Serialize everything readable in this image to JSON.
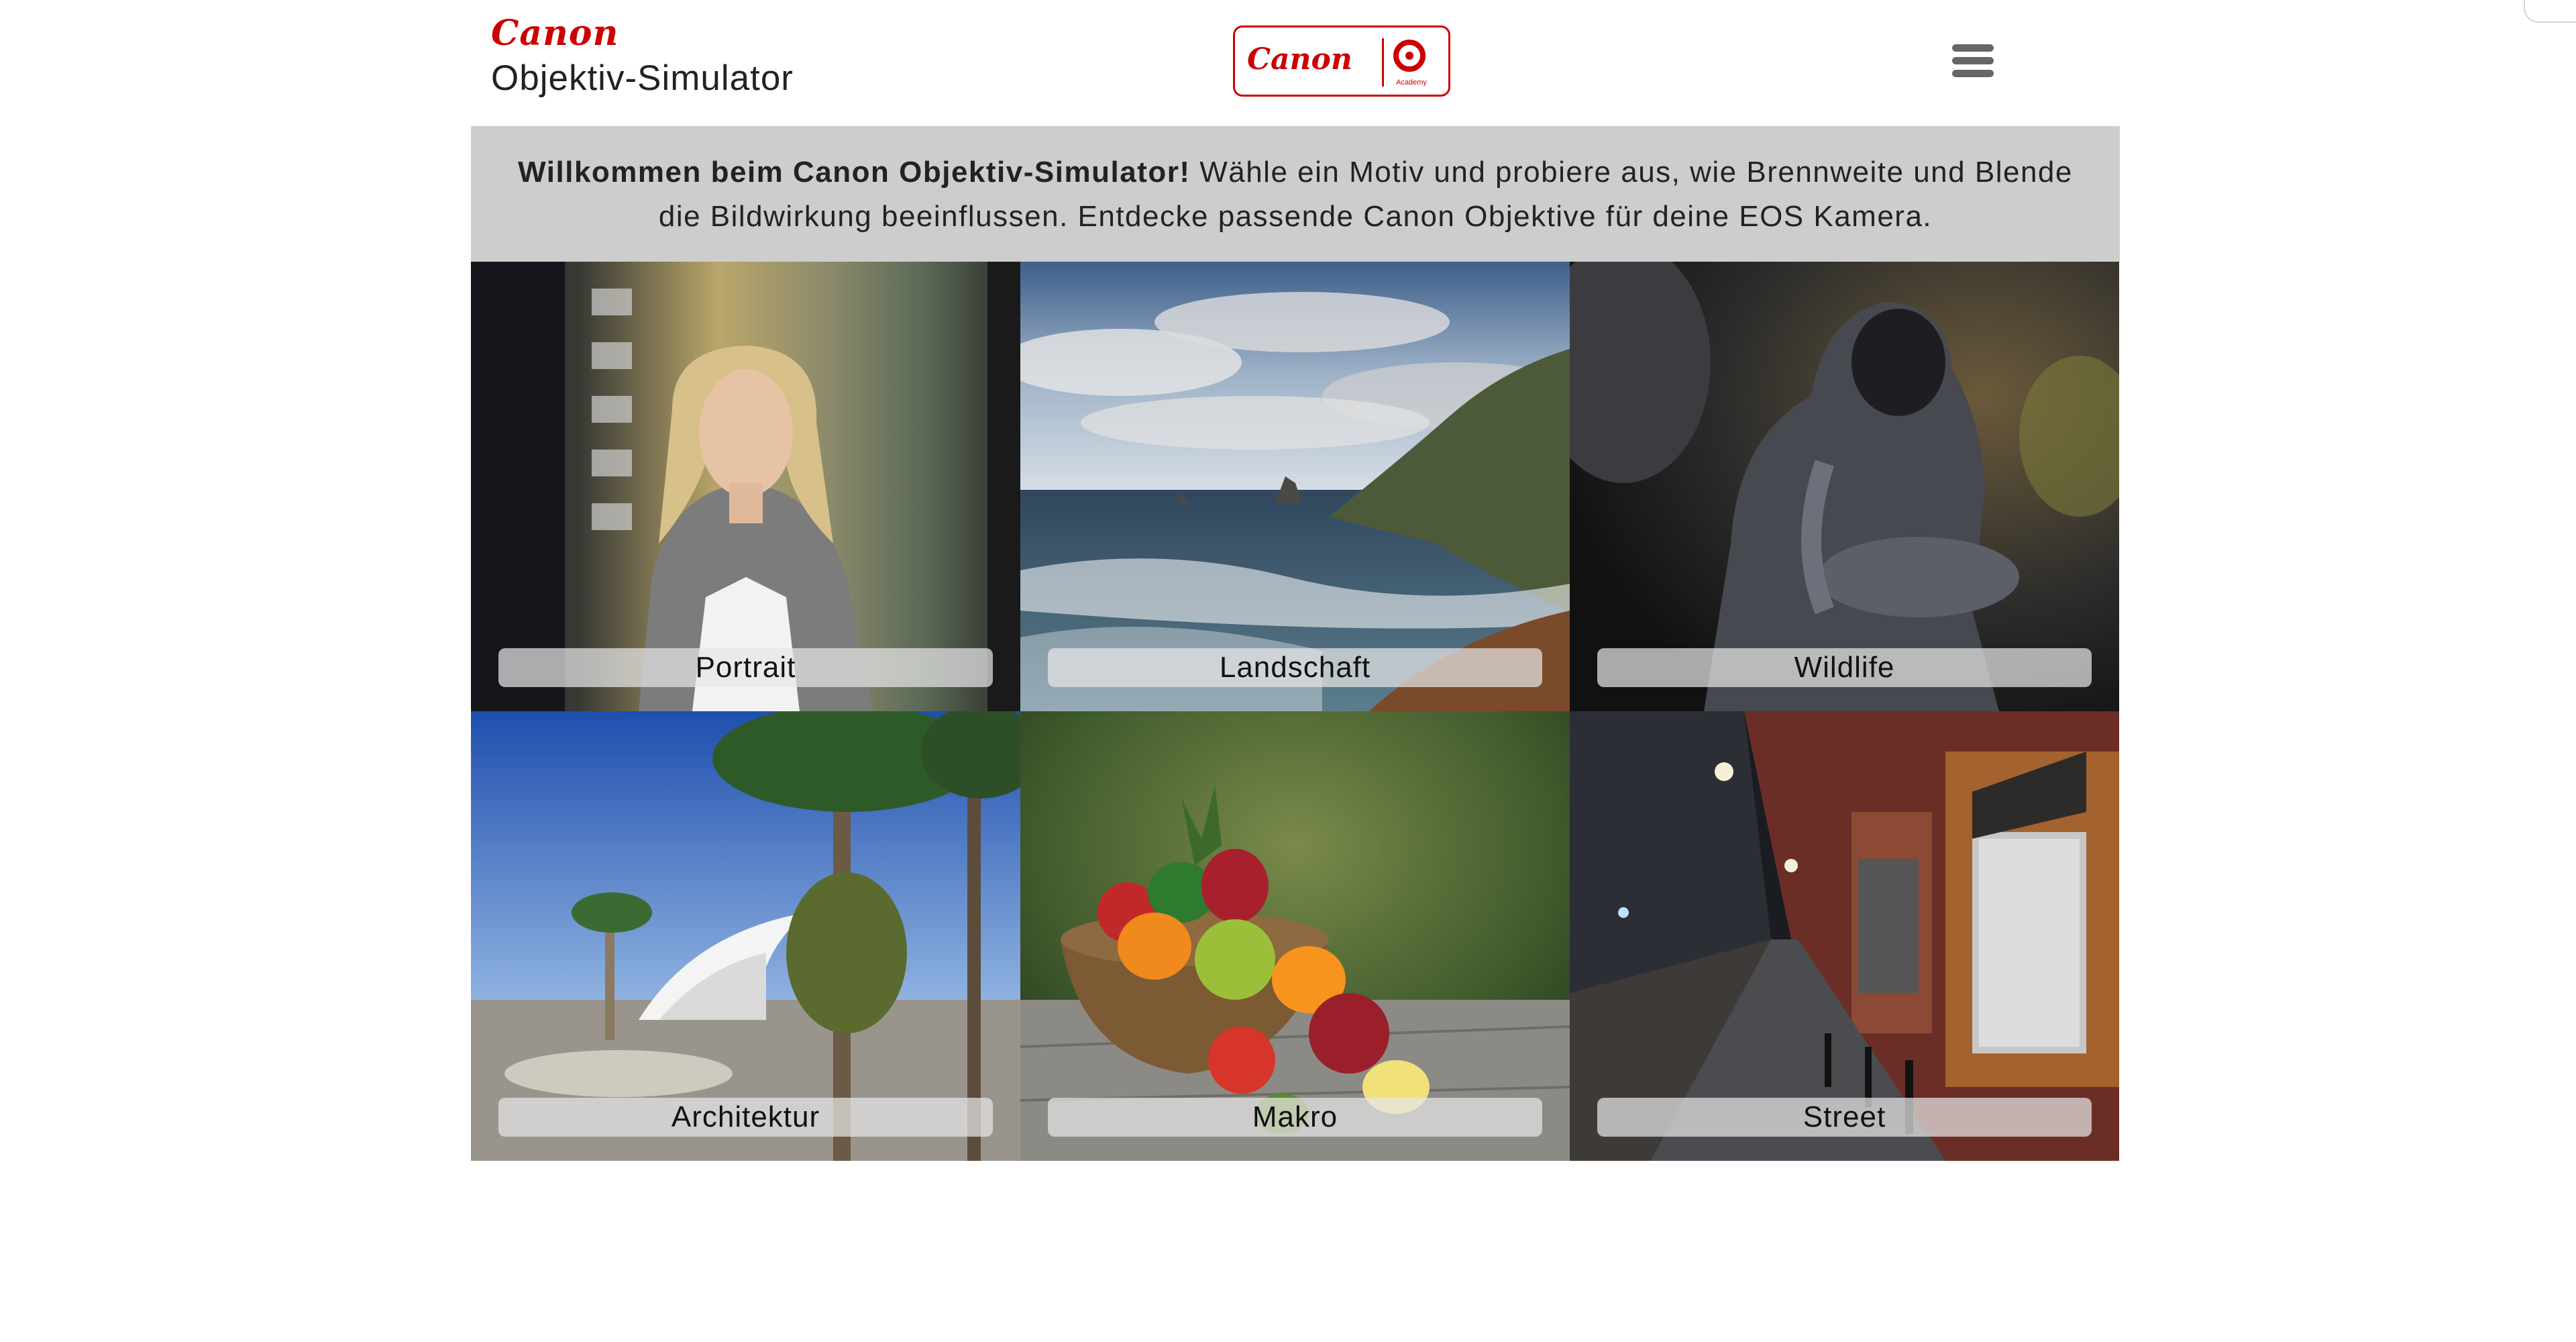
{
  "header": {
    "brand": "Canon",
    "title": "Objektiv-Simulator",
    "badge": {
      "brand": "Canon",
      "sub": "Academy"
    }
  },
  "intro": {
    "bold": "Willkommen beim Canon Objektiv-Simulator!",
    "text": " Wähle ein Motiv und probiere aus, wie Brennweite und Blende die Bildwirkung beeinflussen. Entdecke passende Canon Objektive für deine EOS Kamera."
  },
  "tiles": [
    {
      "label": "Portrait"
    },
    {
      "label": "Landschaft"
    },
    {
      "label": "Wildlife"
    },
    {
      "label": "Architektur"
    },
    {
      "label": "Makro"
    },
    {
      "label": "Street"
    }
  ],
  "icons": {
    "menu": "hamburger-menu-icon",
    "academy": "academy-target-icon"
  },
  "colors": {
    "brand_red": "#cc0000",
    "intro_bg": "#cdcdcd"
  }
}
